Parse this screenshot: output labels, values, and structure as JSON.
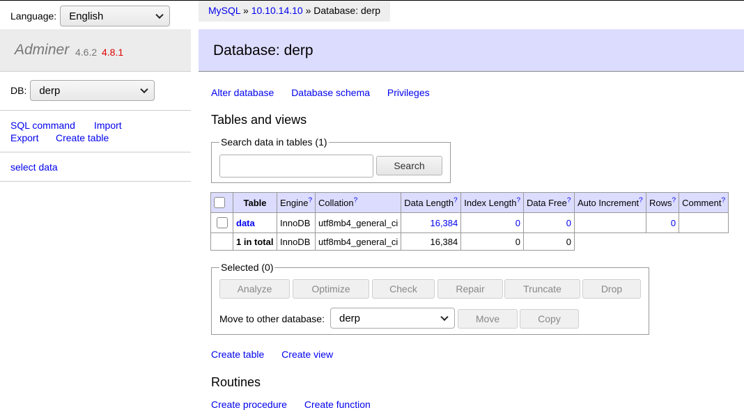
{
  "sidebar": {
    "language_label": "Language:",
    "language_value": "English",
    "brand_name": "Adminer",
    "version": "4.6.2",
    "new_version": "4.8.1",
    "db_label": "DB:",
    "db_value": "derp",
    "links": {
      "sql_command": "SQL command",
      "import": "Import",
      "export": "Export",
      "create_table": "Create table",
      "select_data": "select data"
    }
  },
  "breadcrumb": {
    "driver": "MySQL",
    "sep1": " » ",
    "server": "10.10.14.10",
    "sep2": " » ",
    "current": "Database: derp"
  },
  "page_title": "Database: derp",
  "db_links": {
    "alter": "Alter database",
    "schema": "Database schema",
    "privileges": "Privileges"
  },
  "tables_heading": "Tables and views",
  "search": {
    "legend": "Search data in tables (1)",
    "input_value": "",
    "button": "Search"
  },
  "table": {
    "headers": {
      "table": "Table",
      "engine": "Engine",
      "collation": "Collation",
      "data_length": "Data Length",
      "index_length": "Index Length",
      "data_free": "Data Free",
      "auto_increment": "Auto Increment",
      "rows": "Rows",
      "comment": "Comment",
      "help": "?"
    },
    "row": {
      "name": "data",
      "engine": "InnoDB",
      "collation": "utf8mb4_general_ci",
      "data_length": "16,384",
      "index_length": "0",
      "data_free": "0",
      "auto_increment": "",
      "rows": "0",
      "comment": ""
    },
    "total": {
      "label": "1 in total",
      "engine": "InnoDB",
      "collation": "utf8mb4_general_ci",
      "data_length": "16,384",
      "index_length": "0",
      "data_free": "0"
    }
  },
  "selected": {
    "legend": "Selected (0)",
    "buttons": {
      "analyze": "Analyze",
      "optimize": "Optimize",
      "check": "Check",
      "repair": "Repair",
      "truncate": "Truncate",
      "drop": "Drop",
      "move": "Move",
      "copy": "Copy"
    },
    "move_label": "Move to other database:",
    "move_db": "derp"
  },
  "create_links": {
    "table": "Create table",
    "view": "Create view"
  },
  "routines_heading": "Routines",
  "routine_links": {
    "procedure": "Create procedure",
    "function": "Create function"
  }
}
